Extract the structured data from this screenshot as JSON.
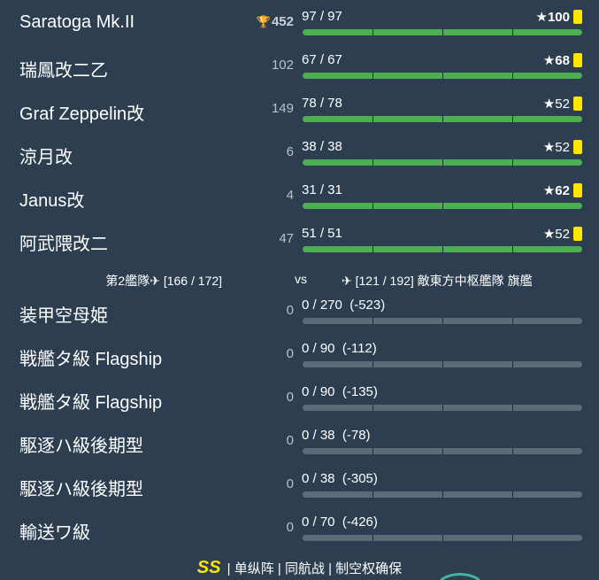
{
  "friendly": [
    {
      "name": "Saratoga Mk.II",
      "level": "452",
      "trophy": true,
      "hp": "97 / 97",
      "hp_frac": 1.0,
      "cond": "★100",
      "cond_bold": true
    },
    {
      "name": "瑞鳳改二乙",
      "level": "102",
      "trophy": false,
      "hp": "67 / 67",
      "hp_frac": 1.0,
      "cond": "★68",
      "cond_bold": true
    },
    {
      "name": "Graf Zeppelin改",
      "level": "149",
      "trophy": false,
      "hp": "78 / 78",
      "hp_frac": 1.0,
      "cond": "★52",
      "cond_bold": false
    },
    {
      "name": "涼月改",
      "level": "6",
      "trophy": false,
      "hp": "38 / 38",
      "hp_frac": 1.0,
      "cond": "★52",
      "cond_bold": false
    },
    {
      "name": "Janus改",
      "level": "4",
      "trophy": false,
      "hp": "31 / 31",
      "hp_frac": 1.0,
      "cond": "★62",
      "cond_bold": true
    },
    {
      "name": "阿武隈改二",
      "level": "47",
      "trophy": false,
      "hp": "51 / 51",
      "hp_frac": 1.0,
      "cond": "★52",
      "cond_bold": false
    }
  ],
  "divider": {
    "left": "第2艦隊✈ [166 / 172]",
    "vs": "vs",
    "right": "✈ [121 / 192] 敵東方中枢艦隊 旗艦"
  },
  "enemy": [
    {
      "name": "装甲空母姫",
      "level": "0",
      "hp": "0 / 270  (-523)",
      "hp_frac": 0
    },
    {
      "name": "戦艦タ級 Flagship",
      "level": "0",
      "hp": "0 / 90  (-112)",
      "hp_frac": 0
    },
    {
      "name": "戦艦タ級 Flagship",
      "level": "0",
      "hp": "0 / 90  (-135)",
      "hp_frac": 0
    },
    {
      "name": "駆逐ハ級後期型",
      "level": "0",
      "hp": "0 / 38  (-78)",
      "hp_frac": 0
    },
    {
      "name": "駆逐ハ級後期型",
      "level": "0",
      "hp": "0 / 38  (-305)",
      "hp_frac": 0
    },
    {
      "name": "輸送ワ級",
      "level": "0",
      "hp": "0 / 70  (-426)",
      "hp_frac": 0
    }
  ],
  "footer": {
    "rank": "SS",
    "info": "| 单纵阵 | 同航战 | 制空权确保"
  },
  "colors": {
    "background": "#2c3e50",
    "hp_green": "#4caf50",
    "bar_empty": "#5c6b78",
    "badge_yellow": "#ffe600"
  },
  "icons": {
    "trophy": "trophy-icon",
    "plane": "plane-icon",
    "condition": "condition-badge"
  }
}
